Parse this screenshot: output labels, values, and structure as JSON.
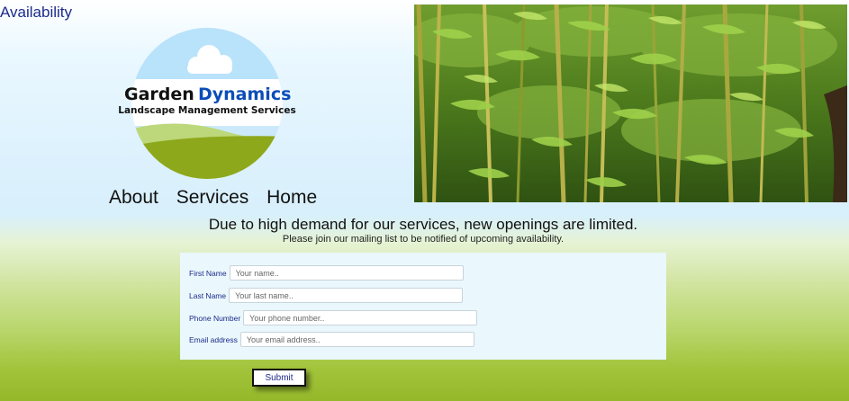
{
  "page_title": "Availability",
  "logo": {
    "brand_first": "Garden",
    "brand_second": "Dynamics",
    "tagline": "Landscape Management Services",
    "accent_color": "#0b4db8"
  },
  "nav": {
    "items": [
      {
        "label": "About"
      },
      {
        "label": "Services"
      },
      {
        "label": "Home"
      }
    ]
  },
  "hero_image": {
    "subject": "bamboo grove"
  },
  "notice": {
    "headline": "Due to high demand for our services, new openings are limited.",
    "subline": "Please join our mailing list to be notified of upcoming availability."
  },
  "form": {
    "fields": [
      {
        "label": "First Name",
        "placeholder": "Your name..",
        "value": ""
      },
      {
        "label": "Last Name",
        "placeholder": "Your last name..",
        "value": ""
      },
      {
        "label": "Phone Number",
        "placeholder": "Your phone number..",
        "value": ""
      },
      {
        "label": "Email address",
        "placeholder": "Your email address..",
        "value": ""
      }
    ],
    "submit_label": "Submit"
  },
  "colors": {
    "link_blue": "#1d2b8c",
    "panel_bg": "#eaf7fc",
    "grass_green": "#94b829"
  }
}
